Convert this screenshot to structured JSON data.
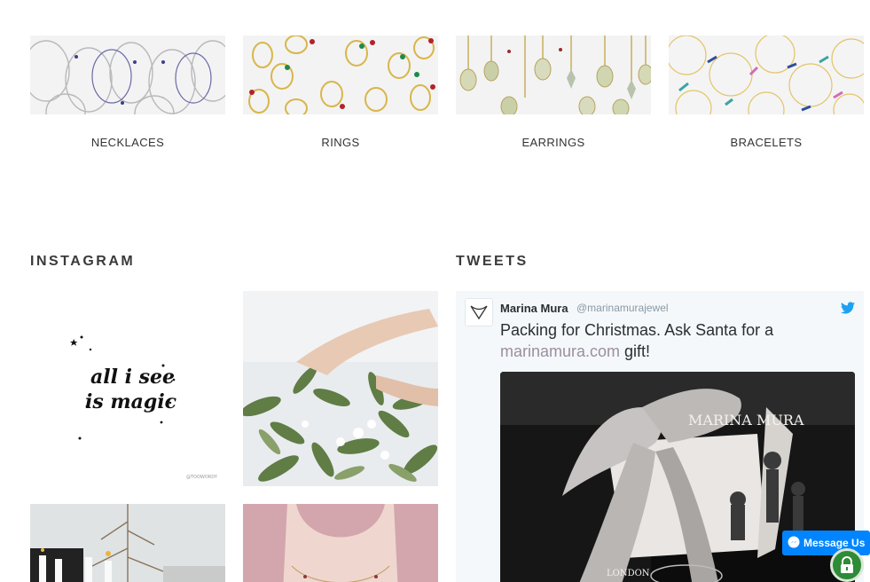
{
  "categories": [
    {
      "label": "NECKLACES",
      "image_icon": "necklaces-image"
    },
    {
      "label": "RINGS",
      "image_icon": "rings-image"
    },
    {
      "label": "EARRINGS",
      "image_icon": "earrings-image"
    },
    {
      "label": "BRACELETS",
      "image_icon": "bracelets-image"
    }
  ],
  "instagram": {
    "title": "INSTAGRAM",
    "tiles": [
      {
        "kind": "quote",
        "quote_line1": "all i see",
        "quote_line2": "is magic",
        "credit": "@TOOWORDY"
      },
      {
        "kind": "photo",
        "subject": "olive-wreath"
      },
      {
        "kind": "photo",
        "subject": "candles-tree"
      },
      {
        "kind": "photo",
        "subject": "necklace-model"
      }
    ]
  },
  "tweets": {
    "title": "TWEETS",
    "tweet": {
      "author_name": "Marina Mura",
      "author_handle": "@marinamurajewel",
      "text_before": "Packing for Christmas. Ask Santa for a",
      "link_text": "marinamura.com",
      "text_after": " gift!",
      "media_ribbon_text": "MARINA MURA",
      "media_ribbon_sub": "LONDON"
    }
  },
  "messenger": {
    "label": "Message Us",
    "icon": "messenger-icon"
  },
  "security_badge": {
    "icon": "lock-icon"
  },
  "colors": {
    "link": "#9b8fa0",
    "twitter": "#1da1f2",
    "messenger": "#0084ff",
    "badge": "#2e8b37"
  }
}
